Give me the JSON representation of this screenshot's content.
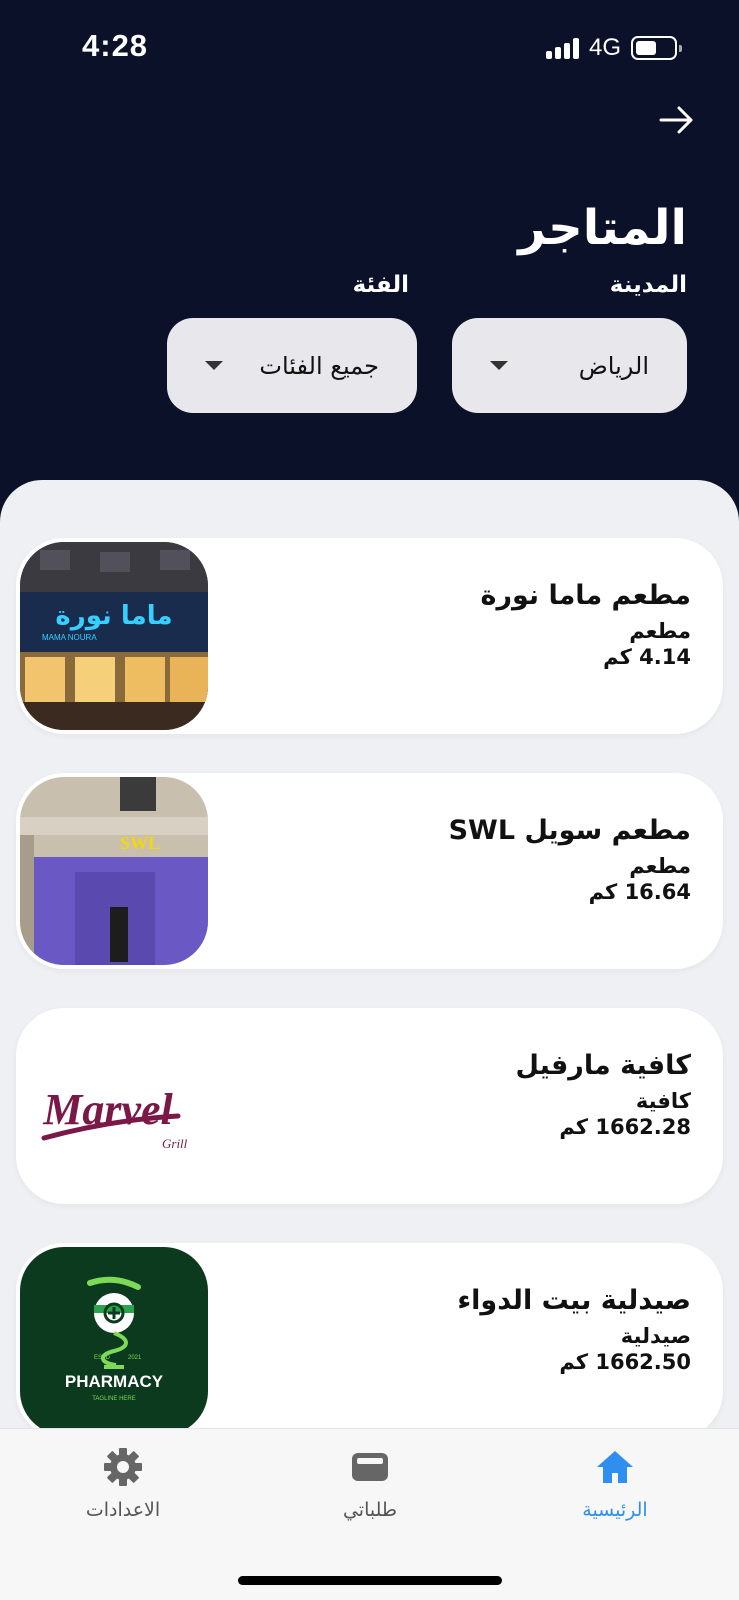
{
  "status_bar": {
    "time": "4:28",
    "network": "4G"
  },
  "header": {
    "title": "المتاجر",
    "city_label": "المدينة",
    "category_label": "الفئة",
    "city_value": "الرياض",
    "category_value": "جميع الفئات"
  },
  "stores": [
    {
      "name": "مطعم ماما نورة",
      "category": "مطعم",
      "distance": "4.14 كم",
      "sign_text": "ماما نورة",
      "sign_text_en": "MAMA NOURA"
    },
    {
      "name": "مطعم سويل SWL",
      "category": "مطعم",
      "distance": "16.64 كم",
      "sign_text": "SWL"
    },
    {
      "name": "كافية مارفيل",
      "category": "كافية",
      "distance": "1662.28 كم",
      "logo_text": "Marvel",
      "logo_sub": "Grill"
    },
    {
      "name": "صيدلية بيت الدواء",
      "category": "صيدلية",
      "distance": "1662.50 كم",
      "logo_text": "PHARMACY",
      "logo_sub": "TAGLINE HERE",
      "logo_estd": "ESTD",
      "logo_year": "2021"
    }
  ],
  "tabs": {
    "home": "الرئيسية",
    "orders": "طلباتي",
    "settings": "الاعدادات"
  },
  "colors": {
    "header_bg": "#0a1128",
    "content_bg": "#eff0f4",
    "accent": "#2f8ff0"
  }
}
